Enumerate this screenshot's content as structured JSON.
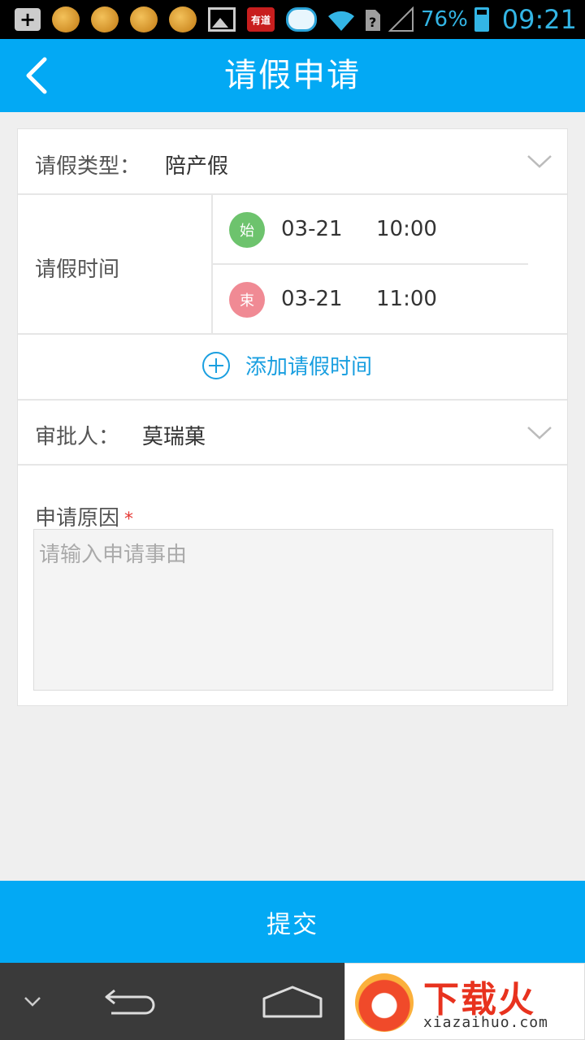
{
  "status_bar": {
    "youdao_label": "有道",
    "battery_percent": "76%",
    "time": "09:21"
  },
  "header": {
    "title": "请假申请"
  },
  "form": {
    "leave_type": {
      "label": "请假类型：",
      "value": "陪产假"
    },
    "leave_time": {
      "label": "请假时间",
      "start": {
        "badge": "始",
        "date": "03-21",
        "time": "10:00"
      },
      "end": {
        "badge": "束",
        "date": "03-21",
        "time": "11:00"
      }
    },
    "add_time_label": "添加请假时间",
    "approver": {
      "label": "审批人：",
      "value": "莫瑞菓"
    },
    "reason": {
      "label": "申请原因",
      "required_mark": "*",
      "placeholder": "请输入申请事由",
      "value": ""
    }
  },
  "submit_label": "提交",
  "watermark": {
    "title": "下载火",
    "subtitle": "xiazaihuo.com"
  },
  "colors": {
    "primary": "#03a9f4",
    "start_badge": "#6dc36d",
    "end_badge": "#f08a94",
    "link": "#1a9fe0",
    "required": "#e53935"
  }
}
